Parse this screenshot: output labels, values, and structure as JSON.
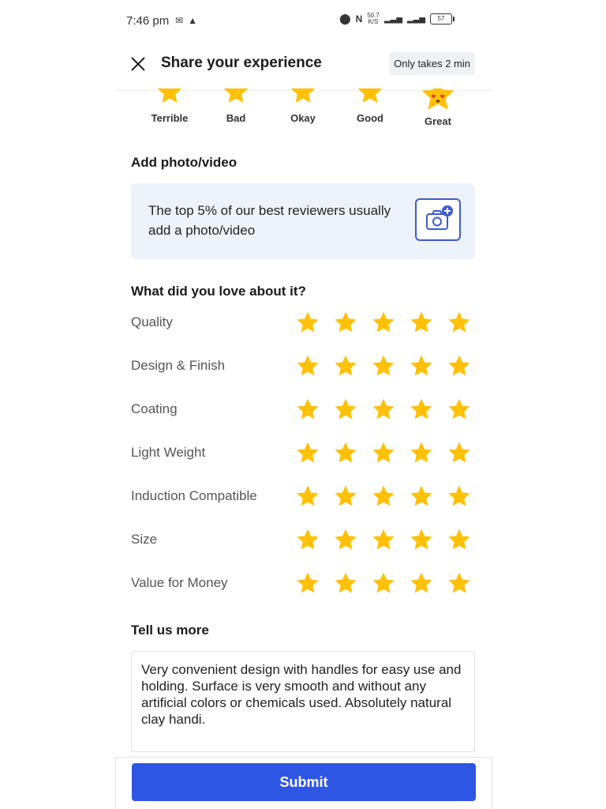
{
  "status_bar": {
    "time": "7:46 pm",
    "left_icons": [
      "mail-icon",
      "navigation-icon"
    ],
    "net_speed": "50.7",
    "net_unit": "K/S",
    "battery": "57"
  },
  "header": {
    "title": "Share your experience",
    "time_badge": "Only takes 2 min"
  },
  "overall_rating": {
    "options": [
      "Terrible",
      "Bad",
      "Okay",
      "Good",
      "Great"
    ],
    "selected": "Great",
    "star_color": "#FFC107"
  },
  "photo_section": {
    "title": "Add photo/video",
    "message": "The top 5% of our best reviewers usually add a photo/video"
  },
  "attributes": {
    "title": "What did you love about it?",
    "items": [
      {
        "label": "Quality",
        "rating": 5
      },
      {
        "label": "Design & Finish",
        "rating": 5
      },
      {
        "label": "Coating",
        "rating": 5
      },
      {
        "label": "Light Weight",
        "rating": 5
      },
      {
        "label": "Induction Compatible",
        "rating": 5
      },
      {
        "label": "Size",
        "rating": 5
      },
      {
        "label": "Value for Money",
        "rating": 5
      }
    ],
    "max_rating": 5
  },
  "review": {
    "title": "Tell us more",
    "text": "Very convenient design with handles for easy use and holding. Surface is very smooth and without any artificial colors or chemicals used. Absolutely natural clay handi."
  },
  "footer": {
    "submit_label": "Submit",
    "accent_color": "#2F55E4"
  }
}
